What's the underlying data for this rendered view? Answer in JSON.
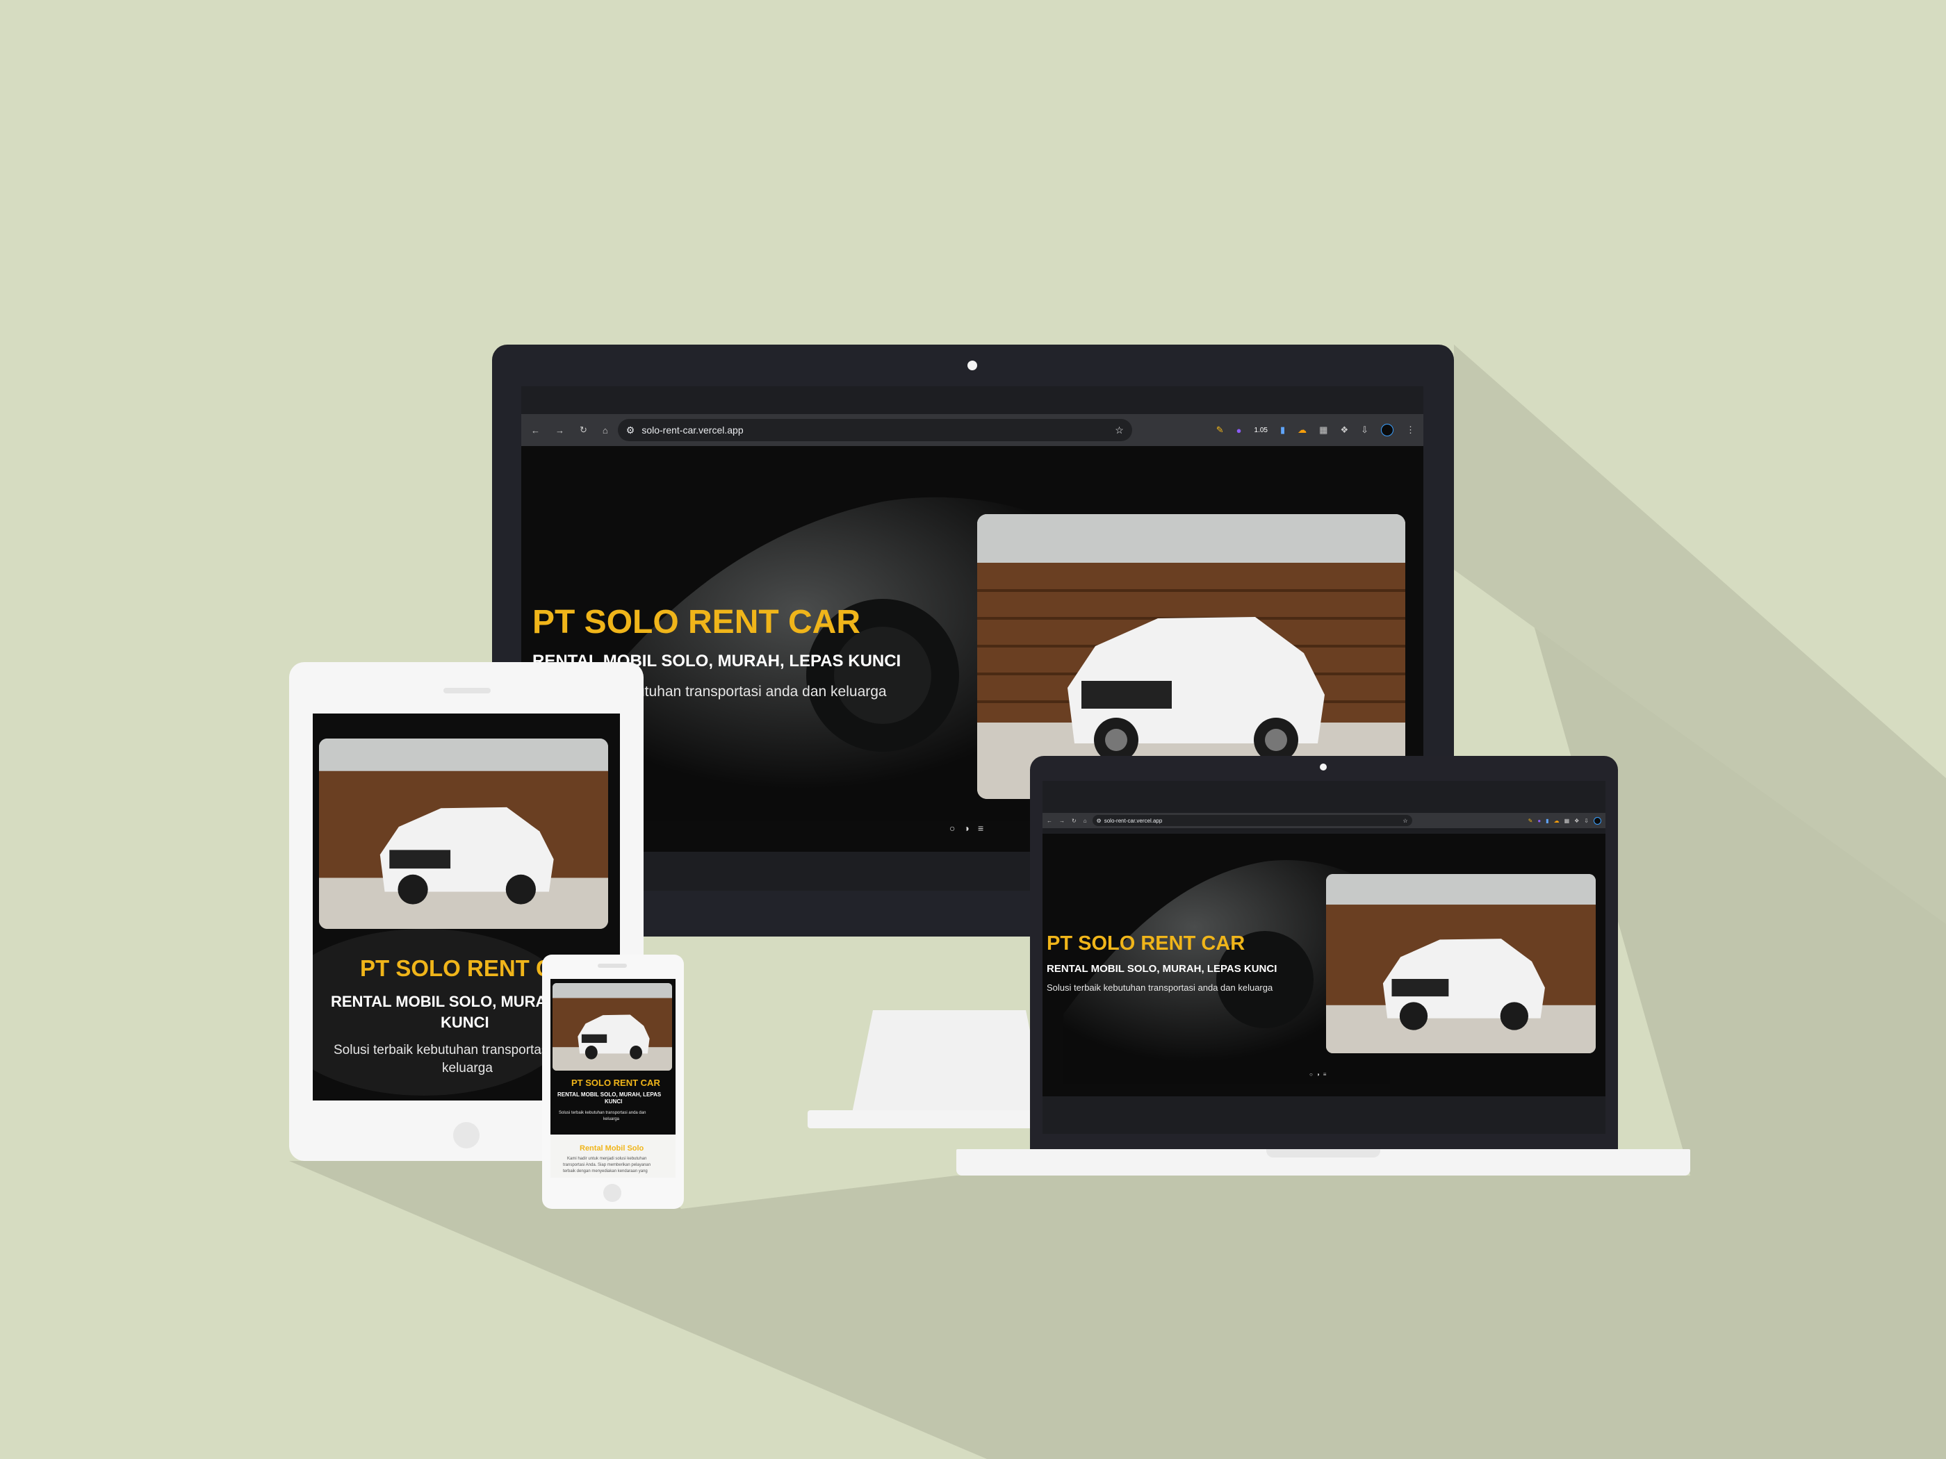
{
  "site": {
    "url": "solo-rent-car.vercel.app",
    "brand": "PT SOLO RENT CAR",
    "subtitle": "RENTAL MOBIL SOLO, MURAH, LEPAS KUNCI",
    "tagline": "Solusi terbaik kebutuhan transportasi anda dan keluarga",
    "section_title": "Rental Mobil Solo",
    "section_text": "Kami hadir untuk menjadi solusi kebutuhan transportasi Anda. Siap memberikan pelayanan terbaik dengan menyediakan kendaraan yang"
  },
  "monitor": {
    "tagline_visible": "utuhan transportasi anda dan keluarga"
  },
  "tablet": {
    "brand_visible": "PT SOLO RENT CA",
    "subtitle_line1": "RENTAL MOBIL SOLO, MURAH",
    "subtitle_line2": "KUNCI",
    "tagline_line1": "Solusi terbaik kebutuhan transportasi",
    "tagline_line2": "keluarga"
  },
  "phone": {
    "subtitle_line1": "RENTAL MOBIL SOLO, MURAH, LEPAS",
    "subtitle_line2": "KUNCI",
    "tagline_line1": "Solusi terbaik kebutuhan transportasi anda dan",
    "tagline_line2": "keluarga",
    "section_line1": "Kami hadir untuk menjadi solusi kebutuhan",
    "section_line2": "transportasi Anda. Siap memberikan pelayanan",
    "section_line3": "terbaik dengan menyediakan kendaraan yang"
  },
  "browser": {
    "ext_badge": "1.05"
  },
  "icons": [
    "back-icon",
    "forward-icon",
    "reload-icon",
    "home-icon",
    "site-settings-icon",
    "bookmark-star-icon",
    "pencil-extension-icon",
    "purple-extension-icon",
    "document-extension-icon",
    "cloud-extension-icon",
    "grid-extension-icon",
    "extensions-puzzle-icon",
    "download-icon",
    "profile-avatar-icon",
    "menu-kebab-icon",
    "chat-icon",
    "theme-toggle-icon",
    "list-icon"
  ],
  "colors": {
    "background": "#d6dcc1",
    "shadow": "#c0c5ac",
    "brand_yellow": "#f0b51a",
    "device_dark": "#22232a",
    "device_white": "#f6f6f6"
  }
}
